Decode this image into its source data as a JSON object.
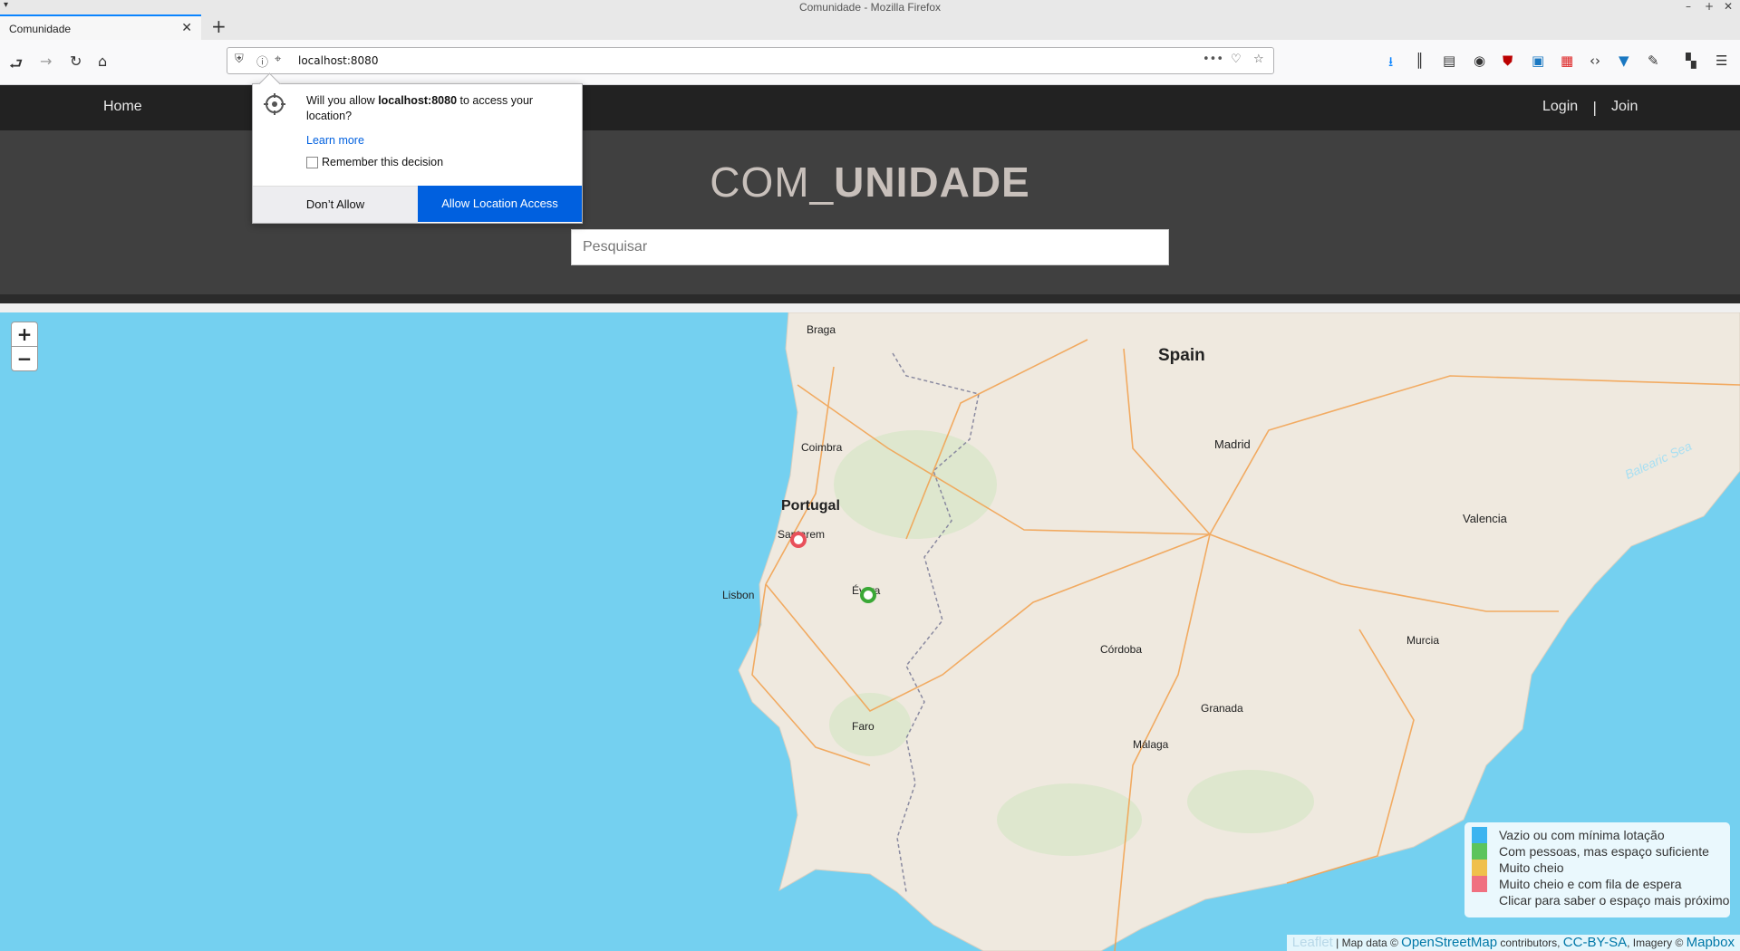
{
  "window": {
    "title": "Comunidade - Mozilla Firefox"
  },
  "tab": {
    "label": "Comunidade"
  },
  "address_bar": {
    "url": "localhost:8080"
  },
  "site_nav": {
    "home": "Home",
    "login": "Login",
    "separator": "|",
    "join": "Join"
  },
  "brand": {
    "part1": "COM_",
    "part2": "UNIDADE"
  },
  "search": {
    "placeholder": "Pesquisar"
  },
  "permission": {
    "prefix": "Will you allow ",
    "host": "localhost:8080",
    "suffix": " to access your location?",
    "learn_more": "Learn more",
    "remember": "Remember this decision",
    "deny": "Don’t Allow",
    "allow": "Allow Location Access"
  },
  "map": {
    "zoom_in": "+",
    "zoom_out": "−",
    "labels": {
      "portugal": "Portugal",
      "spain": "Spain",
      "madrid": "Madrid",
      "lisbon": "Lisbon",
      "santarem": "Santarem",
      "evora": "Évora",
      "faro": "Faro",
      "porto": "Braga",
      "coimbra": "Coimbra",
      "valencia": "Valencia",
      "murcia": "Murcia",
      "cordoba": "Córdoba",
      "granada": "Granada",
      "malaga": "Málaga",
      "sea": "Balearic Sea"
    },
    "markers": [
      {
        "status": "Muito cheio e com fila de espera",
        "color": "#e8505b"
      },
      {
        "status": "Com pessoas, mas espaço suficiente",
        "color": "#3aa836"
      }
    ]
  },
  "legend": [
    {
      "label": "Vazio ou com mínima lotação",
      "color": "#3cb4f0"
    },
    {
      "label": "Com pessoas, mas espaço suficiente",
      "color": "#5cc45c"
    },
    {
      "label": "Muito cheio",
      "color": "#f0c04c"
    },
    {
      "label": "Muito cheio e com fila de espera",
      "color": "#f07080"
    },
    {
      "label": "Clicar para saber o espaço mais próximo",
      "color": ""
    }
  ],
  "attribution": {
    "leaflet": "Leaflet",
    "text1": " | Map data © ",
    "osm": "OpenStreetMap",
    "text2": " contributors, ",
    "license": "CC-BY-SA",
    "text3": ", Imagery © ",
    "mapbox": "Mapbox"
  }
}
